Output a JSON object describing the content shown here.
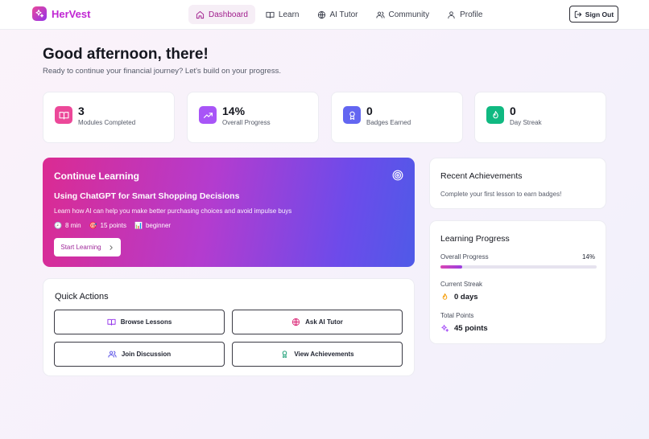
{
  "header": {
    "brand": "HerVest",
    "nav": [
      {
        "label": "Dashboard",
        "icon": "home-icon",
        "active": true
      },
      {
        "label": "Learn",
        "icon": "book-icon"
      },
      {
        "label": "AI Tutor",
        "icon": "globe-icon"
      },
      {
        "label": "Community",
        "icon": "users-icon"
      },
      {
        "label": "Profile",
        "icon": "user-icon"
      }
    ],
    "signout_label": "Sign Out"
  },
  "greeting": {
    "title": "Good afternoon, there!",
    "subtitle": "Ready to continue your financial journey? Let's build on your progress."
  },
  "stats": [
    {
      "value": "3",
      "label": "Modules Completed",
      "icon": "book-icon",
      "color": "#ec4899"
    },
    {
      "value": "14%",
      "label": "Overall Progress",
      "icon": "trending-up-icon",
      "color": "#a855f7"
    },
    {
      "value": "0",
      "label": "Badges Earned",
      "icon": "award-icon",
      "color": "#6366f1"
    },
    {
      "value": "0",
      "label": "Day Streak",
      "icon": "flame-icon",
      "color": "#10b981"
    }
  ],
  "continue_learning": {
    "title": "Continue Learning",
    "lesson_title": "Using ChatGPT for Smart Shopping Decisions",
    "lesson_desc": "Learn how AI can help you make better purchasing choices and avoid impulse buys",
    "duration": "8 min",
    "points": "15 points",
    "level": "beginner",
    "button_label": "Start Learning"
  },
  "quick_actions": {
    "title": "Quick Actions",
    "buttons": [
      {
        "label": "Browse Lessons",
        "icon": "book-icon"
      },
      {
        "label": "Ask AI Tutor",
        "icon": "globe-icon"
      },
      {
        "label": "Join Discussion",
        "icon": "users-icon"
      },
      {
        "label": "View Achievements",
        "icon": "award-icon"
      }
    ]
  },
  "recent_achievements": {
    "title": "Recent Achievements",
    "empty_text": "Complete your first lesson to earn badges!"
  },
  "learning_progress": {
    "title": "Learning Progress",
    "overall_label": "Overall Progress",
    "overall_pct": "14%",
    "overall_value": 0.14,
    "streak_label": "Current Streak",
    "streak_value": "0 days",
    "points_label": "Total Points",
    "points_value": "45 points"
  },
  "colors": {
    "brand": "#c026d3",
    "accent_gradient_start": "#db2b92",
    "accent_gradient_end": "#4f5ae8"
  }
}
